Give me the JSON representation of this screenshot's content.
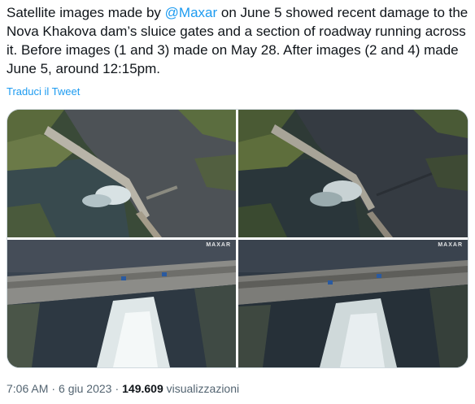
{
  "tweet": {
    "text_part1": "Satellite images made by ",
    "mention": "@Maxar",
    "text_part2": " on June 5 showed recent damage to the Nova Khakova dam’s sluice gates and a section of roadway running across it. Before images (1 and 3) made on May 28. After images (2 and 4) made June 5, around 12:15pm.",
    "translate_label": "Traduci il Tweet"
  },
  "media": {
    "images": [
      {
        "name": "before-wide"
      },
      {
        "name": "after-wide"
      },
      {
        "name": "before-closeup",
        "watermark": "MAXAR"
      },
      {
        "name": "after-closeup",
        "watermark": "MAXAR"
      }
    ]
  },
  "meta": {
    "time": "7:06 AM",
    "separator": "·",
    "date": "6 giu 2023",
    "views_count": "149.609",
    "views_label": "visualizzazioni"
  },
  "colors": {
    "link": "#1d9bf0",
    "text": "#0f1419",
    "secondary": "#536471"
  }
}
